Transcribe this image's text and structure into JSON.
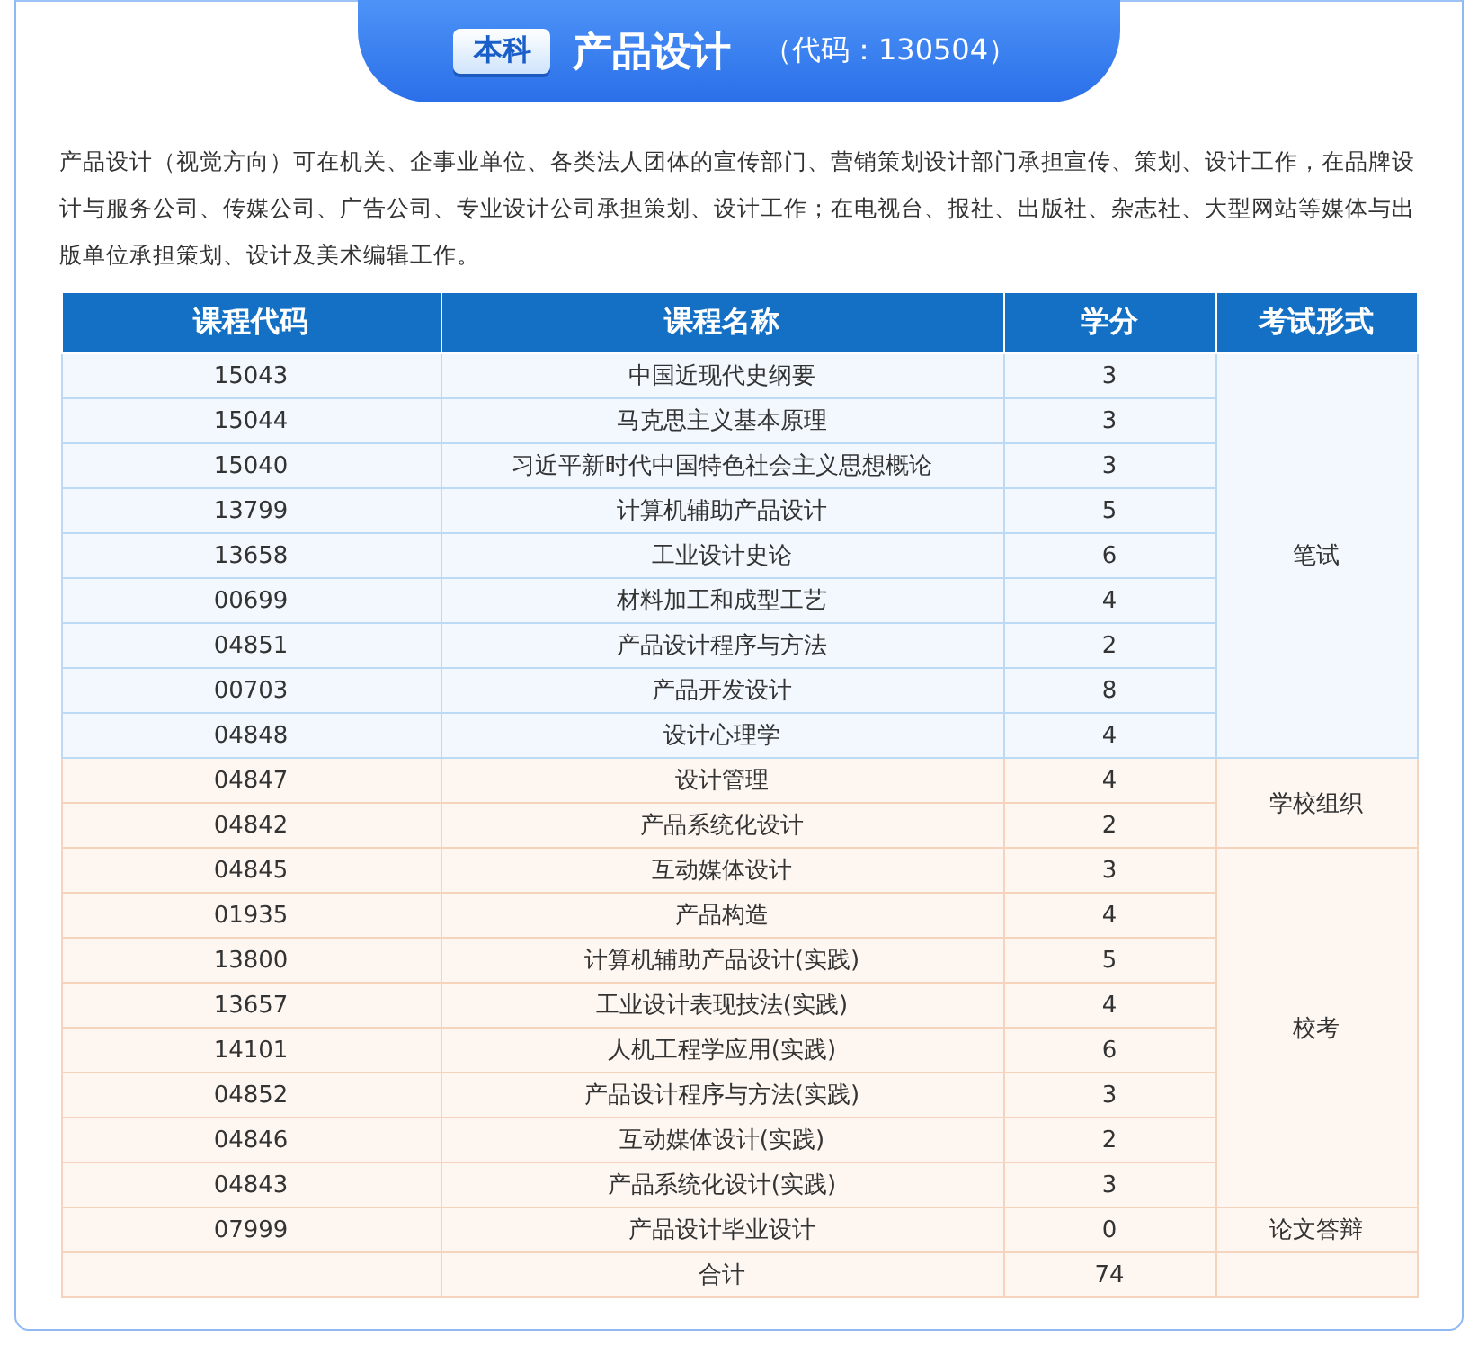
{
  "header": {
    "level_badge": "本科",
    "title": "产品设计",
    "code": "（代码：130504）"
  },
  "description": "产品设计（视觉方向）可在机关、企事业单位、各类法人团体的宣传部门、营销策划设计部门承担宣传、策划、设计工作，在品牌设计与服务公司、传媒公司、广告公司、专业设计公司承担策划、设计工作；在电视台、报社、出版社、杂志社、大型网站等媒体与出版单位承担策划、设计及美术编辑工作。",
  "table": {
    "columns": [
      "课程代码",
      "课程名称",
      "学分",
      "考试形式"
    ],
    "groups": [
      {
        "kind": "written",
        "exam": "笔试",
        "rows": [
          {
            "code": "15043",
            "name": "中国近现代史纲要",
            "credits": "3"
          },
          {
            "code": "15044",
            "name": "马克思主义基本原理",
            "credits": "3"
          },
          {
            "code": "15040",
            "name": "习近平新时代中国特色社会主义思想概论",
            "credits": "3"
          },
          {
            "code": "13799",
            "name": "计算机辅助产品设计",
            "credits": "5"
          },
          {
            "code": "13658",
            "name": "工业设计史论",
            "credits": "6"
          },
          {
            "code": "00699",
            "name": "材料加工和成型工艺",
            "credits": "4"
          },
          {
            "code": "04851",
            "name": "产品设计程序与方法",
            "credits": "2"
          },
          {
            "code": "00703",
            "name": "产品开发设计",
            "credits": "8"
          },
          {
            "code": "04848",
            "name": "设计心理学",
            "credits": "4"
          }
        ]
      },
      {
        "kind": "school",
        "exam": "学校组织",
        "rows": [
          {
            "code": "04847",
            "name": "设计管理",
            "credits": "4"
          },
          {
            "code": "04842",
            "name": "产品系统化设计",
            "credits": "2"
          }
        ]
      },
      {
        "kind": "school",
        "exam": "校考",
        "rows": [
          {
            "code": "04845",
            "name": "互动媒体设计",
            "credits": "3"
          },
          {
            "code": "01935",
            "name": "产品构造",
            "credits": "4"
          },
          {
            "code": "13800",
            "name": "计算机辅助产品设计(实践)",
            "credits": "5"
          },
          {
            "code": "13657",
            "name": "工业设计表现技法(实践)",
            "credits": "4"
          },
          {
            "code": "14101",
            "name": "人机工程学应用(实践)",
            "credits": "6"
          },
          {
            "code": "04852",
            "name": "产品设计程序与方法(实践)",
            "credits": "3"
          },
          {
            "code": "04846",
            "name": "互动媒体设计(实践)",
            "credits": "2"
          },
          {
            "code": "04843",
            "name": "产品系统化设计(实践)",
            "credits": "3"
          }
        ]
      },
      {
        "kind": "school",
        "exam": "论文答辩",
        "rows": [
          {
            "code": "07999",
            "name": "产品设计毕业设计",
            "credits": "0"
          }
        ]
      }
    ],
    "total": {
      "label": "合计",
      "credits": "74"
    }
  }
}
